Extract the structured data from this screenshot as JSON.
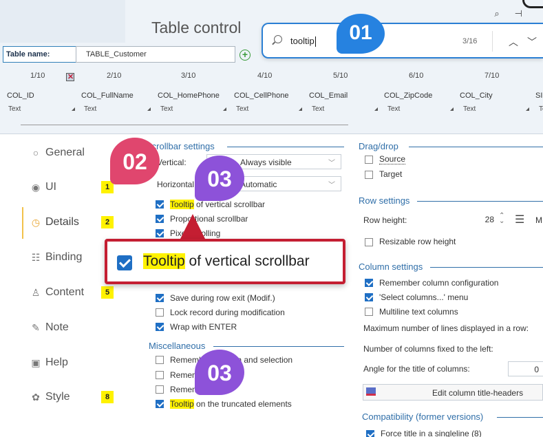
{
  "header": {
    "title": "Table control",
    "table_name_label": "Table name:",
    "table_name_value": "TABLE_Customer"
  },
  "search": {
    "value": "tooltip",
    "count": "3/16"
  },
  "badges": {
    "b01": "01",
    "b02": "02",
    "b03": "03"
  },
  "columns": {
    "positions": [
      "1/10",
      "2/10",
      "3/10",
      "4/10",
      "5/10",
      "6/10",
      "7/10"
    ],
    "names": [
      "COL_ID",
      "COL_FullName",
      "COL_HomePhone",
      "COL_CellPhone",
      "COL_Email",
      "COL_ZipCode",
      "COL_City",
      "SI"
    ],
    "types": [
      "Text",
      "Text",
      "Text",
      "Text",
      "Text",
      "Text",
      "Text",
      "Te"
    ]
  },
  "sidebar": {
    "items": [
      {
        "label": "General",
        "icon": "radio-icon",
        "num": ""
      },
      {
        "label": "UI",
        "icon": "eye-icon",
        "num": "1"
      },
      {
        "label": "Details",
        "icon": "clock-icon",
        "num": "2"
      },
      {
        "label": "Binding",
        "icon": "binding-icon",
        "num": ""
      },
      {
        "label": "Content",
        "icon": "content-icon",
        "num": "5"
      },
      {
        "label": "Note",
        "icon": "note-icon",
        "num": ""
      },
      {
        "label": "Help",
        "icon": "help-icon",
        "num": ""
      },
      {
        "label": "Style",
        "icon": "style-icon",
        "num": "8"
      }
    ]
  },
  "scrollbar": {
    "title": "Scrollbar settings",
    "vertical_label": "Vertical:",
    "vertical_value": "Always visible",
    "horizontal_label": "Horizontal:",
    "horizontal_value": "Automatic",
    "tooltip_word": "Tooltip",
    "tooltip_rest": " of vertical scrollbar",
    "proportional": "Proportional scrollbar",
    "pixel": "Pixel scrolling"
  },
  "callout": {
    "word": "Tooltip",
    "rest": " of vertical scrollbar"
  },
  "record": {
    "save_exit": "Save during row exit (Modif.)",
    "lock": "Lock record during modification",
    "wrap": "Wrap with ENTER"
  },
  "misc": {
    "title": "Miscellaneous",
    "remember_position": "Remember position and selection",
    "remember_filters": "Remember filters",
    "remember_sorts": "Remember sorts",
    "tooltip_word": "Tooltip",
    "tooltip_rest": " on the truncated elements"
  },
  "dragdrop": {
    "title": "Drag/drop",
    "source": "Source",
    "target": "Target"
  },
  "row_settings": {
    "title": "Row settings",
    "row_height_label": "Row height:",
    "row_height_value": "28",
    "resizable": "Resizable row height"
  },
  "column_settings": {
    "title": "Column settings",
    "remember_config": "Remember column configuration",
    "select_columns": "'Select columns...' menu",
    "multiline": "Multiline text columns",
    "max_lines": "Maximum number of lines displayed in a row:",
    "fixed_left": "Number of columns fixed to the left:",
    "angle": "Angle for the title of columns:",
    "angle_value": "0",
    "edit_button": "Edit column title-headers"
  },
  "compat": {
    "title": "Compatibility (former versions)",
    "force_title": "Force title in a singleline (8)"
  }
}
